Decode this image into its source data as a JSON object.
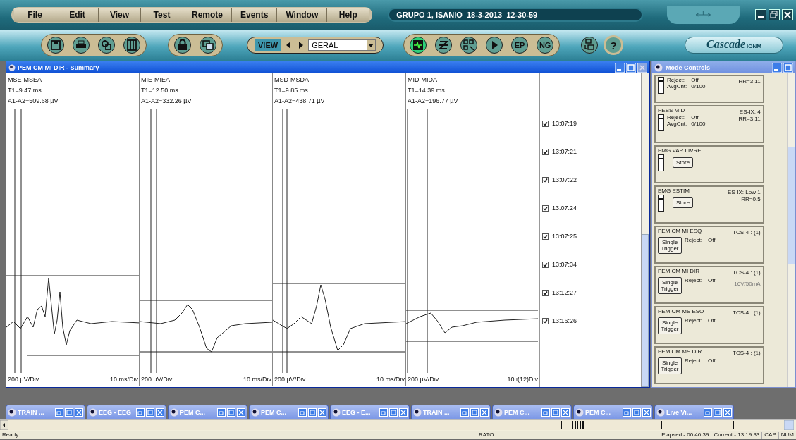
{
  "menu": [
    "File",
    "Edit",
    "View",
    "Test",
    "Remote",
    "Events",
    "Window",
    "Help"
  ],
  "session_title": "GRUPO 1, ISANIO  18-3-2013  12-30-59",
  "toolbar": {
    "view_button": "VIEW",
    "view_select": "GERAL",
    "mode_buttons": [
      {
        "active": true
      },
      {
        "active": false
      },
      {
        "active": false
      },
      {
        "active": false
      },
      {
        "label": "EP",
        "active": false
      },
      {
        "label": "NG",
        "active": false
      }
    ],
    "help_button": "?",
    "logo": "Cascade",
    "logo_suffix": "IONM"
  },
  "summary": {
    "title": "PEM CM MI DIR - Summary",
    "traces": [
      {
        "name": "MSE-MSEA",
        "t1": "T1=9.47 ms",
        "amplitude": "A1-A2=509.68 µV",
        "vscale": "200 µV/Div",
        "hscale": "10 ms/Div"
      },
      {
        "name": "MIE-MIEA",
        "t1": "T1=12.50 ms",
        "amplitude": "A1-A2=332.26 µV",
        "vscale": "200 µV/Div",
        "hscale": "10 ms/Div"
      },
      {
        "name": "MSD-MSDA",
        "t1": "T1=9.85 ms",
        "amplitude": "A1-A2=438.71 µV",
        "vscale": "200 µV/Div",
        "hscale": "10 ms/Div"
      },
      {
        "name": "MID-MIDA",
        "t1": "T1=14.39 ms",
        "amplitude": "A1-A2=196.77 µV",
        "vscale": "200 µV/Div",
        "hscale": "10 i(12)Div"
      }
    ],
    "events": [
      {
        "time": "13:07:19",
        "checked": true
      },
      {
        "time": "13:07:21",
        "checked": true
      },
      {
        "time": "13:07:22",
        "checked": true
      },
      {
        "time": "13:07:24",
        "checked": true
      },
      {
        "time": "13:07:25",
        "checked": true
      },
      {
        "time": "13:07:34",
        "checked": true
      },
      {
        "time": "13:12:27",
        "checked": true
      },
      {
        "time": "13:16:26",
        "checked": true
      }
    ]
  },
  "mode_controls": {
    "title": "Mode Controls",
    "cards": [
      {
        "kind": "average",
        "switch_on": true,
        "reject_label": "Reject:",
        "reject": "Off",
        "avg_label": "AvgCnt:",
        "avg": "0/100",
        "info": [
          "RR=3.11"
        ]
      },
      {
        "kind": "average",
        "switch_on": true,
        "name": "PESS MID",
        "reject_label": "Reject:",
        "reject": "Off",
        "avg_label": "AvgCnt:",
        "avg": "0/100",
        "info": [
          "ES-IX: 4",
          "RR=3.11"
        ]
      },
      {
        "kind": "store",
        "switch_on": true,
        "name": "EMG VAR.LIVRE",
        "button": "Store"
      },
      {
        "kind": "store",
        "switch_on": true,
        "name": "EMG ESTIM",
        "button": "Store",
        "info": [
          "ES-IX: Low 1",
          "RR=0.5"
        ]
      },
      {
        "kind": "trigger",
        "name": "PEM CM MI ESQ",
        "button": "Single Trigger",
        "reject_label": "Reject:",
        "reject": "Off",
        "info": [
          "TCS-4 : (1)"
        ]
      },
      {
        "kind": "trigger",
        "name": "PEM CM MI DIR",
        "button": "Single Trigger",
        "reject_label": "Reject:",
        "reject": "Off",
        "info": [
          "TCS-4 : (1)"
        ],
        "note": "16V/50mA"
      },
      {
        "kind": "trigger",
        "name": "PEM CM MS ESQ",
        "button": "Single Trigger",
        "reject_label": "Reject:",
        "reject": "Off",
        "info": [
          "TCS-4 : (1)"
        ]
      },
      {
        "kind": "trigger",
        "name": "PEM CM MS DIR",
        "button": "Single Trigger",
        "reject_label": "Reject:",
        "reject": "Off",
        "info": [
          "TCS-4 : (1)"
        ]
      }
    ]
  },
  "taskbar": [
    "TRAIN ...",
    "EEG - EEG",
    "PEM C...",
    "PEM C...",
    "EEG - E...",
    "TRAIN ...",
    "PEM C...",
    "PEM C...",
    "Live Vi..."
  ],
  "status_bar": {
    "state": "Ready",
    "center": "RATO",
    "elapsed": "Elapsed - 00:46:39",
    "current": "Current - 13:19:33",
    "caps": "CAP",
    "num": "NUM"
  }
}
